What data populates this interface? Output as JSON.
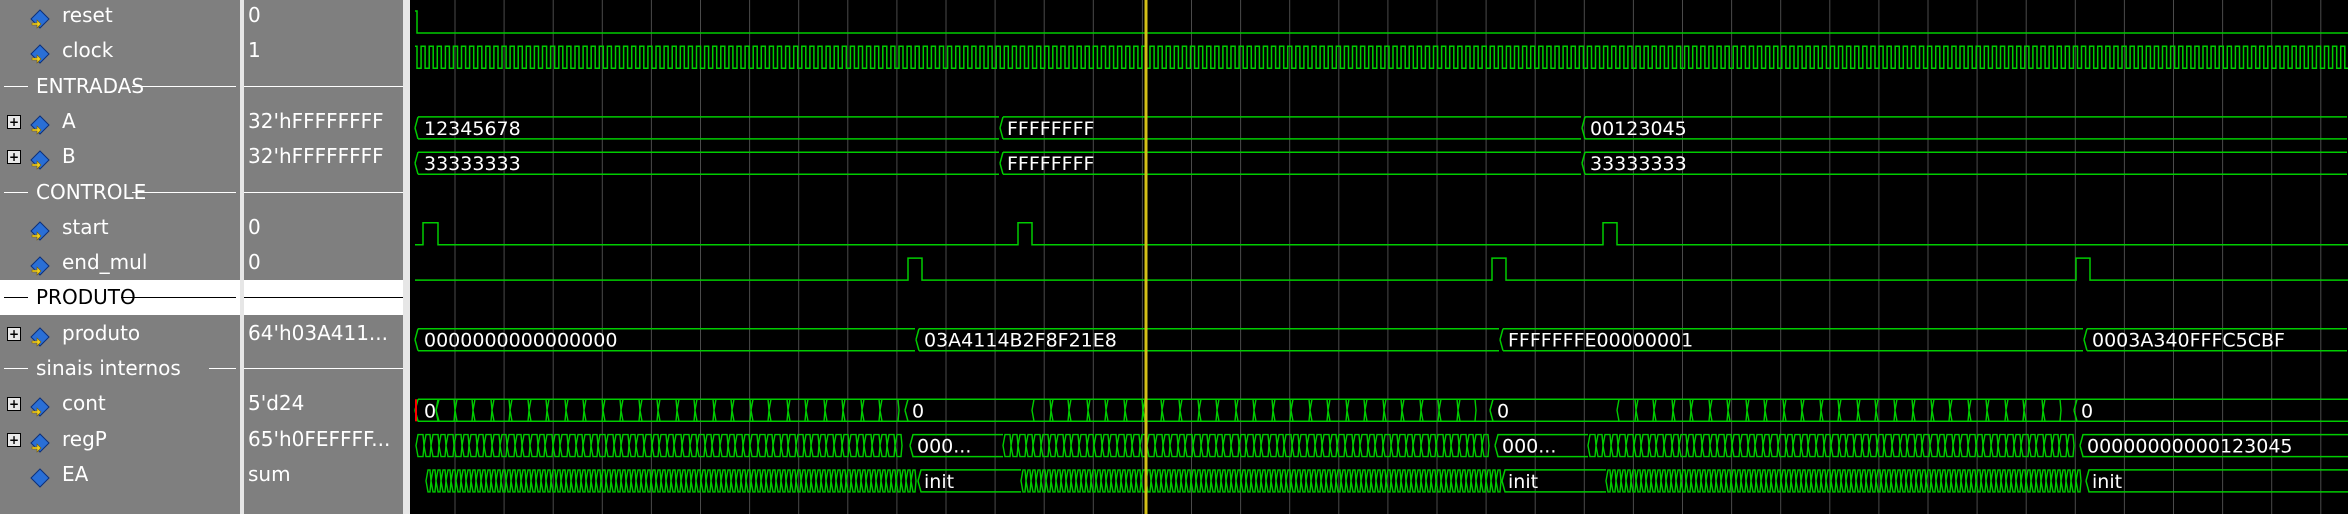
{
  "signals": [
    {
      "kind": "signal",
      "name": "reset",
      "value": "0",
      "expandable": false,
      "icon": "bit-signal-icon"
    },
    {
      "kind": "signal",
      "name": "clock",
      "value": "1",
      "expandable": false,
      "icon": "bit-signal-icon"
    },
    {
      "kind": "divider",
      "name": "ENTRADAS",
      "value": ""
    },
    {
      "kind": "signal",
      "name": "A",
      "value": "32'hFFFFFFFF",
      "expandable": true,
      "icon": "bus-signal-icon"
    },
    {
      "kind": "signal",
      "name": "B",
      "value": "32'hFFFFFFFF",
      "expandable": true,
      "icon": "bus-signal-icon"
    },
    {
      "kind": "divider",
      "name": "CONTROLE",
      "value": ""
    },
    {
      "kind": "signal",
      "name": "start",
      "value": "0",
      "expandable": false,
      "icon": "bit-signal-icon"
    },
    {
      "kind": "signal",
      "name": "end_mul",
      "value": "0",
      "expandable": false,
      "icon": "bit-signal-icon"
    },
    {
      "kind": "divider",
      "name": "PRODUTO",
      "value": "",
      "selected": true
    },
    {
      "kind": "signal",
      "name": "produto",
      "value": "64'h03A411...",
      "expandable": true,
      "icon": "bus-signal-icon"
    },
    {
      "kind": "divider",
      "name": "sinais internos",
      "value": ""
    },
    {
      "kind": "signal",
      "name": "cont",
      "value": "5'd24",
      "expandable": true,
      "icon": "bus-signal-icon"
    },
    {
      "kind": "signal",
      "name": "regP",
      "value": "65'h0FEFFFF...",
      "expandable": true,
      "icon": "bus-signal-icon"
    },
    {
      "kind": "signal",
      "name": "EA",
      "value": "sum",
      "expandable": false,
      "icon": "enum-signal-icon"
    }
  ],
  "wave_labels": {
    "A": [
      "12345678",
      "FFFFFFFF",
      "00123045"
    ],
    "B": [
      "33333333",
      "FFFFFFFF",
      "33333333"
    ],
    "produto": [
      "0000000000000000",
      "03A4114B2F8F21E8",
      "FFFFFFFE00000001",
      "0003A340FFFC5CBF"
    ],
    "cont": [
      "0",
      "0",
      "0",
      "0"
    ],
    "regP": [
      "000...",
      "000...",
      "00000000000123045"
    ],
    "EA": [
      "init",
      "init",
      "init"
    ]
  },
  "colors": {
    "wave": "#00cc00",
    "bus_text": "#ffffff",
    "cursor": "#d4c017",
    "grid": "#4a4a4a",
    "reset_marker": "#ff0000"
  }
}
